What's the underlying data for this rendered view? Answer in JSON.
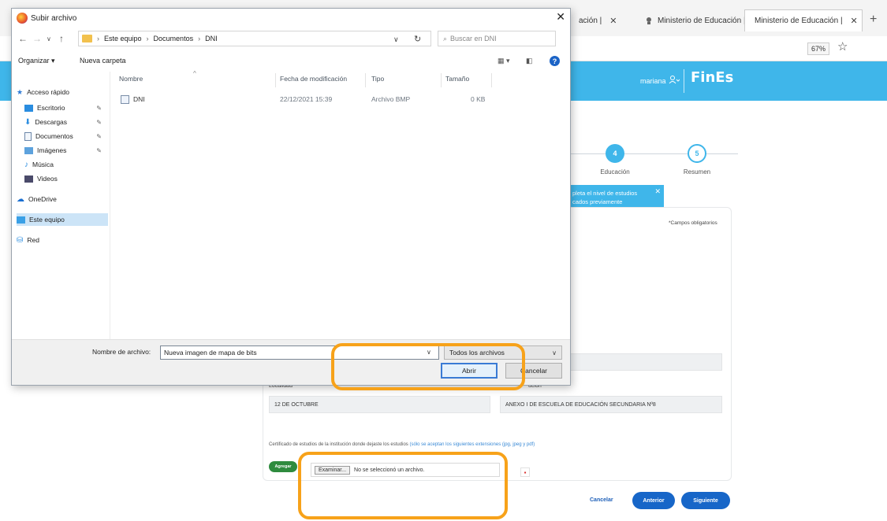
{
  "browser": {
    "tabs": [
      {
        "label": "ación | "
      },
      {
        "label": "Ministerio de Educación | "
      },
      {
        "label": "Ministerio de Educación | "
      }
    ],
    "tab_close": "✕",
    "newtab": "+",
    "zoom": "67%"
  },
  "site": {
    "user": "mariana",
    "brand": "FinEs",
    "steps": [
      {
        "num": "4",
        "label": "Educación"
      },
      {
        "num": "5",
        "label": "Resumen"
      }
    ],
    "tooltip": "pleta el nivel de estudios\ncados previamente",
    "required_note": "*Campos obligatorios",
    "fields": {
      "localidad_label": "Localidad*",
      "localidad_value": "12 DE OCTUBRE",
      "institucion_label": "ución*",
      "institucion_value": "ANEXO I DE ESCUELA DE EDUCACIÓN SECUNDARIA Nº8"
    },
    "cert_text": "Certificado de estudios de la institución donde dejaste los estudios",
    "cert_link": "(sólo se aceptan los siguientes extensiones (jpg, jpeg y pdf)",
    "add_button": "Agregar",
    "file_button": "Examinar...",
    "file_status": "No se seleccionó un archivo.",
    "buttons": {
      "cancel": "Cancelar",
      "prev": "Anterior",
      "next": "Siguiente"
    }
  },
  "dialog": {
    "title": "Subir archivo",
    "breadcrumb": [
      "Este equipo",
      "Documentos",
      "DNI"
    ],
    "search_placeholder": "Buscar en DNI",
    "toolbar": {
      "organize": "Organizar ▾",
      "new_folder": "Nueva carpeta"
    },
    "sidebar": [
      {
        "label": "Acceso rápido",
        "pin": false
      },
      {
        "label": "Escritorio",
        "pin": true
      },
      {
        "label": "Descargas",
        "pin": true
      },
      {
        "label": "Documentos",
        "pin": true
      },
      {
        "label": "Imágenes",
        "pin": true
      },
      {
        "label": "Música",
        "pin": false
      },
      {
        "label": "Videos",
        "pin": false
      },
      {
        "label": "OneDrive",
        "pin": false
      },
      {
        "label": "Este equipo",
        "pin": false
      },
      {
        "label": "Red",
        "pin": false
      }
    ],
    "columns": [
      "Nombre",
      "Fecha de modificación",
      "Tipo",
      "Tamaño"
    ],
    "files": [
      {
        "name": "DNI",
        "date": "22/12/2021 15:39",
        "type": "Archivo BMP",
        "size": "0 KB"
      }
    ],
    "filename_label": "Nombre de archivo:",
    "filename_value": "Nueva imagen de mapa de bits",
    "filetype": "Todos los archivos",
    "open_button": "Abrir",
    "cancel_button": "Cancelar"
  },
  "colors": {
    "accent": "#3fb6ea",
    "primary_button": "#1766c8",
    "highlight": "#f7a21a",
    "add_button": "#2e8b3e"
  }
}
